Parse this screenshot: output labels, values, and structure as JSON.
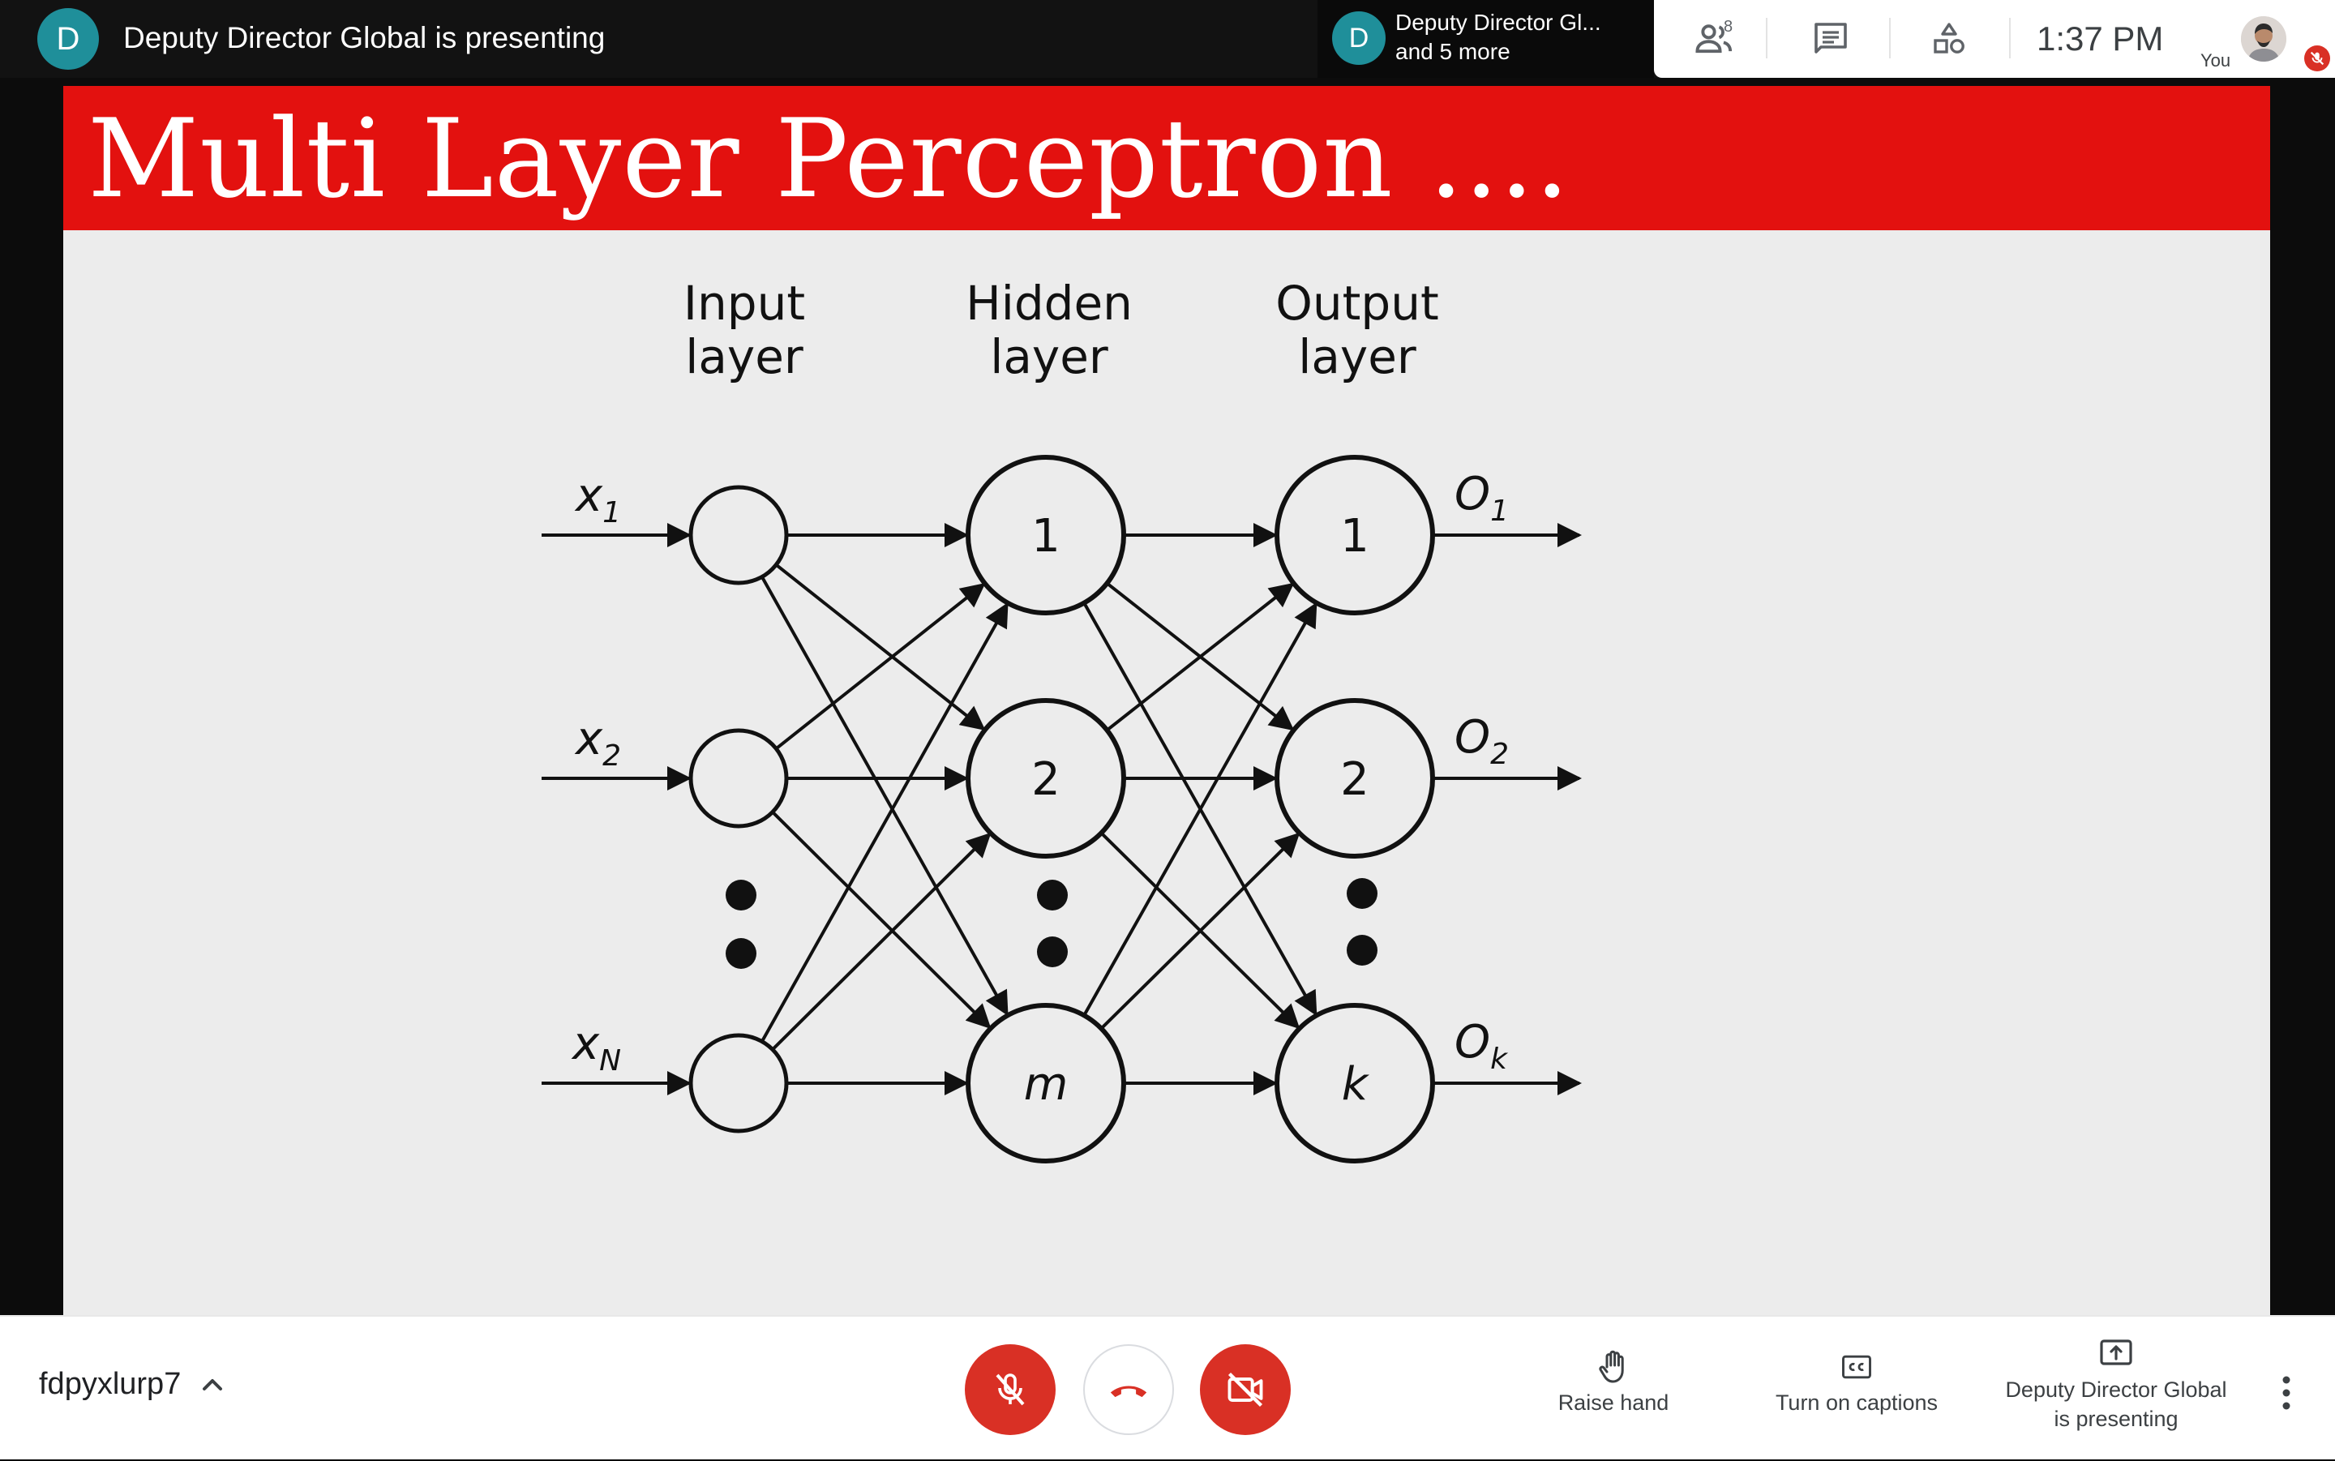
{
  "topbar": {
    "presenter_initial": "D",
    "presenting_title": "Deputy Director Global is presenting",
    "chip_initial": "D",
    "chip_line1": "Deputy Director Gl...",
    "chip_line2": "and 5 more",
    "people_count": "8",
    "clock": "1:37  PM",
    "you_label": "You"
  },
  "slide": {
    "title": "Multi Layer Perceptron ....",
    "diagram": {
      "layer_labels": [
        {
          "line1": "Input",
          "line2": "layer"
        },
        {
          "line1": "Hidden",
          "line2": "layer"
        },
        {
          "line1": "Output",
          "line2": "layer"
        }
      ],
      "inputs": [
        {
          "var": "x",
          "sub": "1"
        },
        {
          "var": "x",
          "sub": "2"
        },
        {
          "var": "x",
          "sub": "N"
        }
      ],
      "hidden_nodes": [
        "1",
        "2",
        "m"
      ],
      "output_nodes": [
        "1",
        "2",
        "k"
      ],
      "outputs": [
        {
          "var": "O",
          "sub": "1"
        },
        {
          "var": "O",
          "sub": "2"
        },
        {
          "var": "O",
          "sub": "k"
        }
      ]
    }
  },
  "bottombar": {
    "meeting_code": "fdpyxlurp7",
    "raise_hand": "Raise hand",
    "captions": "Turn on captions",
    "present_line1": "Deputy Director Global",
    "present_line2": "is presenting"
  },
  "colors": {
    "title_band": "#e3110f",
    "avatar_teal": "#1f8f9a",
    "danger_red": "#d93025"
  },
  "icons": [
    "people-icon",
    "chat-icon",
    "activities-icon",
    "chevron-up-icon",
    "mic-off-icon",
    "call-end-icon",
    "camera-off-icon",
    "hand-icon",
    "captions-icon",
    "present-icon",
    "more-vert-icon",
    "mic-off-badge-icon"
  ]
}
